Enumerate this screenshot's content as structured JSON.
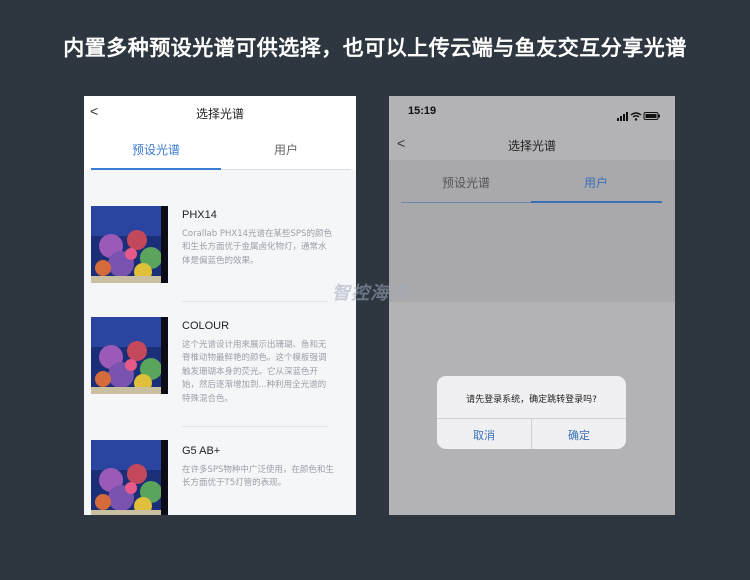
{
  "headline": "内置多种预设光谱可供选择，也可以上传云端与鱼友交互分享光谱",
  "watermark": "智控海洋",
  "left_screen": {
    "back_glyph": "<",
    "title": "选择光谱",
    "tabs": [
      {
        "label": "预设光谱",
        "active": true
      },
      {
        "label": "用户",
        "active": false
      }
    ],
    "spectra": [
      {
        "name": "PHX14",
        "description": "Corallab PHX14光谱在某些SPS的颜色和生长方面优于金属卤化物灯，通常水体是偏蓝色的效果。"
      },
      {
        "name": "COLOUR",
        "description": "这个光谱设计用来展示出珊瑚、鱼和无脊椎动物最鲜艳的颜色。这个模板强调触发珊瑚本身的荧光。它从深蓝色开始，然后逐渐增加到...种利用全光谱的特殊混合色。"
      },
      {
        "name": "G5 AB+",
        "description": "在许多SPS物种中广泛使用，在颜色和生长方面优于T5灯管的表现。"
      }
    ]
  },
  "right_screen": {
    "status": {
      "time": "15:19",
      "icons": [
        "signal-icon",
        "wifi-icon",
        "battery-icon"
      ]
    },
    "back_glyph": "<",
    "title": "选择光谱",
    "tabs": [
      {
        "label": "预设光谱",
        "active": false
      },
      {
        "label": "用户",
        "active": true
      }
    ],
    "dialog": {
      "message": "请先登录系统，确定跳转登录吗?",
      "cancel_label": "取消",
      "confirm_label": "确定"
    }
  },
  "colors": {
    "background": "#2e3740",
    "accent": "#3a7bd5"
  }
}
